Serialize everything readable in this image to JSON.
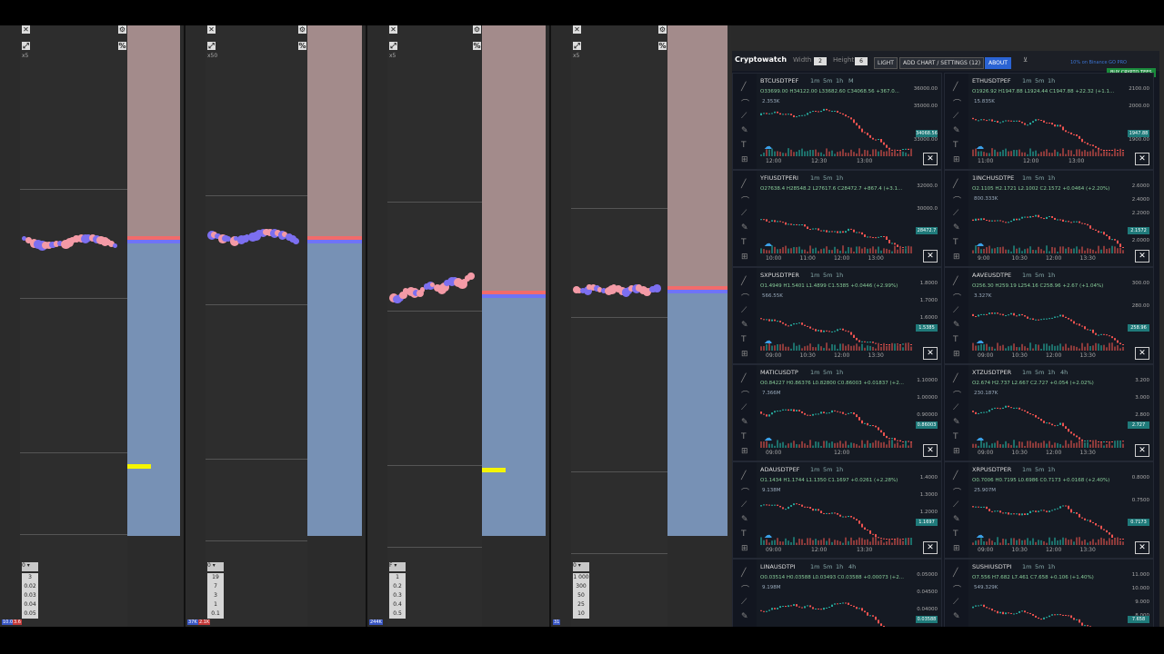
{
  "ladders": [
    {
      "name": "ladder-1",
      "scale_label": "x5",
      "depth_label": "0",
      "depth_values": [
        "3",
        "0.02",
        "0.03",
        "0.04",
        "0.05"
      ],
      "bottom_labels": [
        "10.0",
        "3.6"
      ]
    },
    {
      "name": "ladder-2",
      "scale_label": "x50",
      "depth_label": "0",
      "depth_values": [
        "19",
        "7",
        "3",
        "1",
        "0.1"
      ],
      "bottom_labels": [
        "37K",
        "2.1K"
      ]
    },
    {
      "name": "ladder-3",
      "scale_label": "x5",
      "depth_label": "F",
      "depth_values": [
        "1",
        "0.2",
        "0.3",
        "0.4",
        "0.5"
      ],
      "bottom_labels": [
        "244K"
      ]
    },
    {
      "name": "ladder-4",
      "scale_label": "x5",
      "depth_label": "0",
      "depth_values": [
        "1 000",
        "300",
        "50",
        "25",
        "10"
      ],
      "bottom_labels": [
        "31"
      ]
    }
  ],
  "cryptowatch": {
    "logo": "Cryptowatch",
    "width_label": "Width",
    "width_value": "2",
    "height_label": "Height",
    "height_value": "6",
    "buttons": {
      "light": "LIGHT",
      "add_chart": "ADD CHART / SETTINGS (12)",
      "about": "ABOUT",
      "buy": "BUY CRYPTO TEES"
    },
    "top_right_text": "10% on Binance  GO PRO",
    "charts": [
      {
        "symbol": "BTCUSDTPEF",
        "tfs": [
          "1m",
          "5m",
          "1h",
          "M"
        ],
        "ohlc": "O33699.00 H34122.00 L33682.60 C34068.56 +367.0...",
        "vol": "2.353K",
        "yticks": [
          "36000.00",
          "35000.00",
          "34068.56",
          "33000.00"
        ],
        "last": "34068.56",
        "xticks": [
          "12:00",
          "12:30",
          "13:00"
        ]
      },
      {
        "symbol": "ETHUSDTPEF",
        "tfs": [
          "1m",
          "5m",
          "1h"
        ],
        "ohlc": "O1926.92 H1947.88 L1924.44 C1947.88 +22.32 (+1.1...",
        "vol": "15.835K",
        "yticks": [
          "2100.00",
          "2000.00",
          "1947.88",
          "1900.00"
        ],
        "last": "1947.88",
        "xticks": [
          "11:00",
          "12:00",
          "13:00"
        ]
      },
      {
        "symbol": "YFIUSDTPERI",
        "tfs": [
          "1m",
          "5m",
          "1h"
        ],
        "ohlc": "O27638.4 H28548.2 L27617.6 C28472.7 +867.4 (+3.1...",
        "vol": "",
        "yticks": [
          "32000.0",
          "30000.0",
          "28472.7"
        ],
        "last": "28472.7",
        "xticks": [
          "10:00",
          "11:00",
          "12:00",
          "13:00"
        ]
      },
      {
        "symbol": "1INCHUSDTPE",
        "tfs": [
          "1m",
          "5m",
          "1h"
        ],
        "ohlc": "O2.1105 H2.1721 L2.1002 C2.1572 +0.0464 (+2.20%)",
        "vol": "800.333K",
        "yticks": [
          "2.6000",
          "2.4000",
          "2.2000",
          "2.1572",
          "2.0000"
        ],
        "last": "2.1572",
        "xticks": [
          "9:00",
          "10:30",
          "12:00",
          "13:30"
        ]
      },
      {
        "symbol": "SXPUSDTPER",
        "tfs": [
          "1m",
          "5m",
          "1h"
        ],
        "ohlc": "O1.4949 H1.5401 L1.4899 C1.5385 +0.0446 (+2.99%)",
        "vol": "566.55K",
        "yticks": [
          "1.8000",
          "1.7000",
          "1.6000",
          "1.5385"
        ],
        "last": "1.5385",
        "xticks": [
          "09:00",
          "10:30",
          "12:00",
          "13:30"
        ]
      },
      {
        "symbol": "AAVEUSDTPE",
        "tfs": [
          "1m",
          "5m",
          "1h"
        ],
        "ohlc": "O256.30 H259.19 L254.16 C258.96 +2.67 (+1.04%)",
        "vol": "3.327K",
        "yticks": [
          "300.00",
          "280.00",
          "258.96"
        ],
        "last": "258.96",
        "xticks": [
          "09:00",
          "10:30",
          "12:00",
          "13:30"
        ]
      },
      {
        "symbol": "MATICUSDTP",
        "tfs": [
          "1m",
          "5m",
          "1h"
        ],
        "ohlc": "O0.84227 H0.86376 L0.82800 C0.86003 +0.01837 (+2...",
        "vol": "7.366M",
        "yticks": [
          "1.10000",
          "1.00000",
          "0.90000",
          "0.86003"
        ],
        "last": "0.86003",
        "xticks": [
          "09:00",
          "12:00"
        ]
      },
      {
        "symbol": "XTZUSDTPER",
        "tfs": [
          "1m",
          "5m",
          "1h",
          "4h"
        ],
        "ohlc": "O2.674 H2.737 L2.667 C2.727 +0.054 (+2.02%)",
        "vol": "230.187K",
        "yticks": [
          "3.200",
          "3.000",
          "2.800",
          "2.727"
        ],
        "last": "2.727",
        "xticks": [
          "09:00",
          "10:30",
          "12:00",
          "13:30"
        ]
      },
      {
        "symbol": "ADAUSDTPEF",
        "tfs": [
          "1m",
          "5m",
          "1h"
        ],
        "ohlc": "O1.1434 H1.1744 L1.1350 C1.1697 +0.0261 (+2.28%)",
        "vol": "9.138M",
        "yticks": [
          "1.4000",
          "1.3000",
          "1.2000",
          "1.1697"
        ],
        "last": "1.1697",
        "xticks": [
          "09:00",
          "12:00",
          "13:30"
        ]
      },
      {
        "symbol": "XRPUSDTPER",
        "tfs": [
          "1m",
          "5m",
          "1h"
        ],
        "ohlc": "O0.7006 H0.7195 L0.6986 C0.7173 +0.0168 (+2.40%)",
        "vol": "25.907M",
        "yticks": [
          "0.8000",
          "0.7500",
          "0.7173"
        ],
        "last": "0.7173",
        "xticks": [
          "09:00",
          "10:30",
          "12:00",
          "13:30"
        ]
      },
      {
        "symbol": "LINAUSDTPI",
        "tfs": [
          "1m",
          "5m",
          "1h",
          "4h"
        ],
        "ohlc": "O0.03514 H0.03588 L0.03493 C0.03588 +0.00073 (+2...",
        "vol": "9.198M",
        "yticks": [
          "0.05000",
          "0.04500",
          "0.04000",
          "0.03588"
        ],
        "last": "0.03588",
        "xticks": []
      },
      {
        "symbol": "SUSHIUSDTPI",
        "tfs": [
          "1m",
          "5m",
          "1h"
        ],
        "ohlc": "O7.556 H7.682 L7.461 C7.658 +0.106 (+1.40%)",
        "vol": "549.329K",
        "yticks": [
          "11.000",
          "10.000",
          "9.000",
          "8.000",
          "7.658"
        ],
        "last": "7.658",
        "xticks": []
      }
    ]
  },
  "colors": {
    "ask_zone": "#a38b8b",
    "bid_zone": "#7791b5",
    "price_red": "#f26b6b",
    "price_blue": "#6f73f7",
    "blob_red": "#f49aa6",
    "blob_blue": "#7c6ff0",
    "candle_up": "#26a69a",
    "candle_down": "#ef5350",
    "cw_accent": "#2a63d4"
  }
}
